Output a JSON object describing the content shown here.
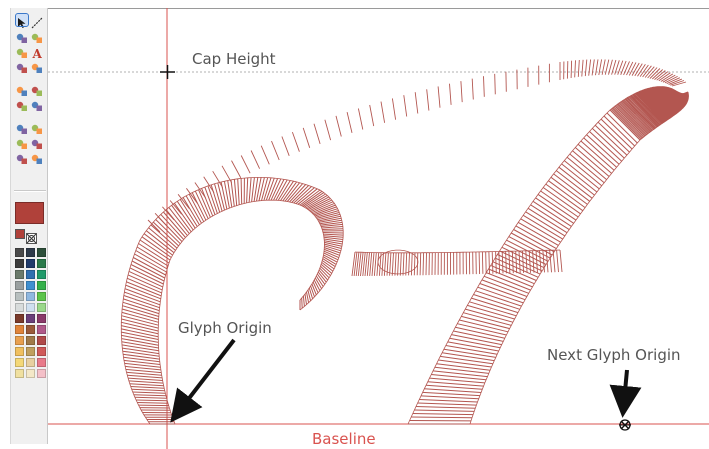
{
  "guides": {
    "cap_height_label": "Cap Height",
    "baseline_label": "Baseline"
  },
  "callouts": {
    "glyph_origin": "Glyph Origin",
    "next_glyph_origin": "Next Glyph Origin"
  },
  "toolbar": {
    "tools": [
      [
        "select-arrow-icon",
        "line-tool-icon"
      ],
      [
        "node-edit-icon",
        "pencil-icon"
      ],
      [
        "shape-tool-icon",
        "text-tool-icon"
      ],
      [
        "stitch-tool-icon",
        "fill-tool-icon"
      ],
      [
        "satin-tool-icon",
        "run-tool-icon"
      ],
      [
        "node-add-icon",
        "node-delete-icon"
      ],
      [
        "transform-icon",
        "star-tool-icon"
      ],
      [
        "mirror-icon",
        "rotate-icon"
      ],
      [
        "magnet-icon",
        "color-wheel-icon"
      ]
    ],
    "current_thread_color": "#b0413a",
    "palette": [
      "#4a4a4a",
      "#2e3a4a",
      "#2d4f3a",
      "#3b3b3b",
      "#1f3a6b",
      "#2a7a4a",
      "#6b7a6b",
      "#2f6fb0",
      "#1f9a6a",
      "#9aa0a0",
      "#3f8fd0",
      "#34b04a",
      "#b8c0c0",
      "#8fb8e0",
      "#5cc44a",
      "#d8dcdc",
      "#cfe0f0",
      "#9ad88a",
      "#7a3a2a",
      "#6a3f7a",
      "#8a3a6a",
      "#e0843a",
      "#9a5a3a",
      "#b05a8a",
      "#e8a050",
      "#a07a4a",
      "#b04a4a",
      "#f0c060",
      "#c0a060",
      "#d05a5a",
      "#f4d878",
      "#e8d0a0",
      "#e87a8a",
      "#f0e0a0",
      "#f4e8c8",
      "#f4c0c8"
    ]
  },
  "colors": {
    "stitch": "#b35650",
    "guide_red": "#d9534f",
    "guide_gray": "#b0b0b0",
    "label_gray": "#555555"
  }
}
